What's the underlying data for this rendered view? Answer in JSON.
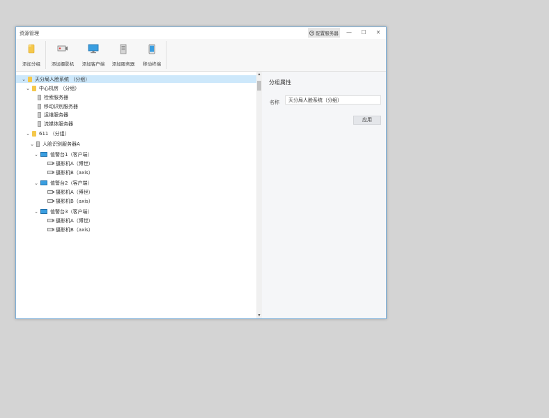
{
  "window": {
    "title": "资源管理"
  },
  "titlebar": {
    "config_label": "配置服务器",
    "minimize": "—",
    "maximize": "☐",
    "close": "✕"
  },
  "toolbar": [
    {
      "label": "添加分组",
      "icon": "folder-icon"
    },
    {
      "label": "添加摄影机",
      "icon": "camera-icon"
    },
    {
      "label": "添加客户端",
      "icon": "monitor-icon"
    },
    {
      "label": "添加服务器",
      "icon": "server-icon"
    },
    {
      "label": "移动终端",
      "icon": "tablet-icon"
    }
  ],
  "tree": [
    {
      "label": "天分局人脸系统 （分组）",
      "icon": "folder",
      "selected": true
    },
    {
      "label": "中心机房 （分组）",
      "icon": "folder"
    },
    {
      "label": "检索服务器",
      "icon": "server"
    },
    {
      "label": "移动识别服务器",
      "icon": "server"
    },
    {
      "label": "运维服务器",
      "icon": "server"
    },
    {
      "label": "流媒体服务器",
      "icon": "server"
    },
    {
      "label": "611 （分组）",
      "icon": "folder"
    },
    {
      "label": "人脸识别服务器A",
      "icon": "server"
    },
    {
      "label": "值警台1（客户端）",
      "icon": "monitor"
    },
    {
      "label": "摄影机A（博世）",
      "icon": "camera"
    },
    {
      "label": "摄影机B（axis）",
      "icon": "camera"
    },
    {
      "label": "值警台2（客户端）",
      "icon": "monitor"
    },
    {
      "label": "摄影机A（博世）",
      "icon": "camera"
    },
    {
      "label": "摄影机B（axis）",
      "icon": "camera"
    },
    {
      "label": "值警台3（客户端）",
      "icon": "monitor"
    },
    {
      "label": "摄影机A（博世）",
      "icon": "camera"
    },
    {
      "label": "摄影机B（axis）",
      "icon": "camera"
    }
  ],
  "properties": {
    "title": "分组属性",
    "name_label": "名称",
    "name_value": "天分局人脸系统（分组）",
    "apply_label": "应用"
  },
  "colors": {
    "accent_border": "#7fb0d8",
    "selection": "#cde8fb",
    "folder": "#f5c84c",
    "monitor": "#3a9ee0"
  }
}
